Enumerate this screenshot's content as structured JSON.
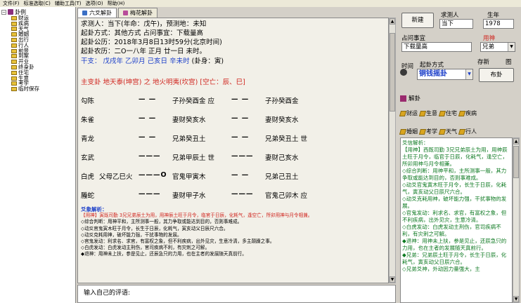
{
  "menu": [
    "文件(F)",
    "标准选取(C)",
    "辅助工具(T)",
    "选项(O)",
    "帮助(H)"
  ],
  "tree": {
    "root": "卦例",
    "items": [
      "财运",
      "疾病",
      "天气",
      "婚姻",
      "出行",
      "行人",
      "前景",
      "到案",
      "开业",
      "终身卦",
      "住宅",
      "生意",
      "考学",
      "临时保存"
    ]
  },
  "tabs": [
    "六爻解卦",
    "梅花解卦"
  ],
  "header": {
    "line1": "求测人：当下(年命：戊午)，预测地：未知",
    "line2": "起卦方式：其他方式     占问事宜：下载量高",
    "line3": "起卦公历：2018年3月8日13时59分(北京时间)",
    "line4": "起卦农历：二O一八年 正月 廿一日 未时。",
    "line5_blue": "干支：   戊戌年   乙卯月   己亥日   辛未时",
    "line5_tail": "(卦身：寅)",
    "line6_red": "主变卦     地天泰(坤宫)    之    地火明夷(坎宫)    [空亡：辰、巳]"
  },
  "gua": [
    {
      "god": "勾陈",
      "fu": "",
      "ben_yao": "— —",
      "ben": "子孙癸酉金 应",
      "bian_yao": "— —",
      "bian": "子孙癸酉金"
    },
    {
      "god": "朱雀",
      "fu": "",
      "ben_yao": "— —",
      "ben": "妻财癸亥水",
      "bian_yao": "— —",
      "bian": "妻财癸亥水"
    },
    {
      "god": "青龙",
      "fu": "",
      "ben_yao": "— —",
      "ben": "兄弟癸丑土",
      "bian_yao": "— —",
      "bian": "兄弟癸丑土 世"
    },
    {
      "god": "玄武",
      "fu": "",
      "ben_yao": "———",
      "ben": "兄弟甲辰土 世",
      "bian_yao": "———",
      "bian": "妻财己亥水"
    },
    {
      "god": "白虎",
      "fu": "父母乙巳火",
      "ben_yao": "———O",
      "ben": "官鬼甲寅木",
      "bian_yao": "— —",
      "bian": "兄弟己丑土"
    },
    {
      "god": "螣蛇",
      "fu": "",
      "ben_yao": "———",
      "ben": "妻财甲子水",
      "bian_yao": "———",
      "bian": "官鬼己卯木 应"
    }
  ],
  "analysis": {
    "title": "爻象解析：",
    "lines": [
      "【用神】寅既司勤 3兄兄弟辰土为用，用神辰土旺于月令，临官于日辰，化耗气，逢空亡，所卯用神与月令相兼。",
      "◇综合判断：用神平和，主所测事一般，其力争取或能达到目的，否则事难成。",
      "◇动爻官鬼寅木旺于月令，长生于日辰，化耗气，寅亥动父日辰尺六合。",
      "◇动爻克耗用神，破坏能力强，干扰事物的发展。",
      "◇官鬼发动：利求名、求官，有富权之象，但不利疾病，出外见灾，生意冷清，多主颠躁之事。",
      "◇白虎发动：白虎发动主刑伤，官司疾病不利，有灾刺之可解。",
      "◆退神：用神未上扶，参是见止，还辰急只的力用，也在主者的发展随天真前行。"
    ]
  },
  "comment_placeholder": "输入自己的评语:",
  "right": {
    "new_button": "新建",
    "asker_label": "求测人",
    "asker_value": "当下",
    "birth_label": "生年",
    "birth_value": "1978",
    "matter_label": "占问事宜",
    "matter_value": "下载量高",
    "yongshen_label": "用神",
    "yongshen_value": "兄弟",
    "time_label": "时间",
    "method_label": "起卦方式",
    "method_value": "铜钱摇卦",
    "save_label": "存新",
    "chart_label": "图",
    "layout_button": "布卦",
    "jiegua_label": "解卦",
    "quick1": [
      "财运",
      "生意",
      "住宅",
      "疾病"
    ],
    "quick2": [
      "婚姻",
      "考学",
      "天气",
      "行人"
    ],
    "text_title": "爻信解析：",
    "text_lines": [
      "【用神】西既司勤 3兄兄弟辰土为用，用神辰土旺于月令，临官于日辰，化耗气，逢空亡，所卯用神与月令相兼。",
      "◇综合判断：用神平和，主所测事一般，其力争取或能达到目的，否则事难成。",
      "◇动爻官鬼寅木旺于月令，长生于日辰，化耗气，寅亥动父日辰尺六合。",
      "◇动爻克耗用神，破坏能力强，干扰事物的发展。",
      "◇官鬼发动：利求名、求官，有富权之象，但不利疾病，出外见灾，生意冷清。",
      "◇白虎发动：白虎发动主刑伤，官司疾病不利，有灾刺之可解。",
      "◆退神：用神未上扶，参是见止，还辰急只的力用，也在主者的发展随天真前行。",
      "◆兄弟：兄弟辰土旺于月令，长生于日辰，化耗气，寅亥动父日辰六合。",
      "◇兄弟爻神，外动因力量强大，主"
    ]
  }
}
